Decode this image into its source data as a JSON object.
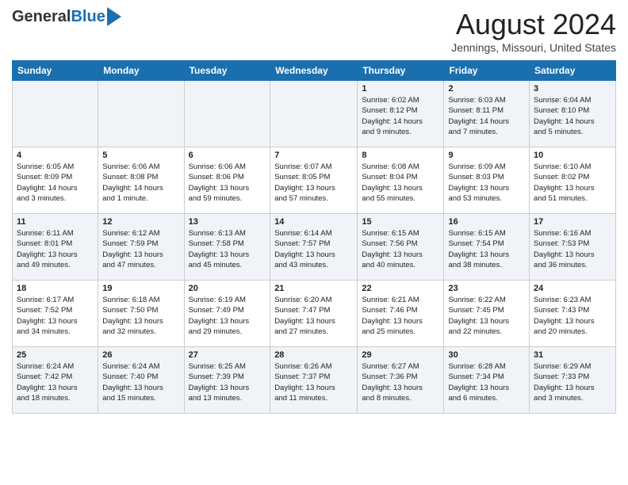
{
  "logo": {
    "general": "General",
    "blue": "Blue"
  },
  "title": "August 2024",
  "location": "Jennings, Missouri, United States",
  "days_of_week": [
    "Sunday",
    "Monday",
    "Tuesday",
    "Wednesday",
    "Thursday",
    "Friday",
    "Saturday"
  ],
  "weeks": [
    [
      {
        "day": "",
        "info": ""
      },
      {
        "day": "",
        "info": ""
      },
      {
        "day": "",
        "info": ""
      },
      {
        "day": "",
        "info": ""
      },
      {
        "day": "1",
        "info": "Sunrise: 6:02 AM\nSunset: 8:12 PM\nDaylight: 14 hours\nand 9 minutes."
      },
      {
        "day": "2",
        "info": "Sunrise: 6:03 AM\nSunset: 8:11 PM\nDaylight: 14 hours\nand 7 minutes."
      },
      {
        "day": "3",
        "info": "Sunrise: 6:04 AM\nSunset: 8:10 PM\nDaylight: 14 hours\nand 5 minutes."
      }
    ],
    [
      {
        "day": "4",
        "info": "Sunrise: 6:05 AM\nSunset: 8:09 PM\nDaylight: 14 hours\nand 3 minutes."
      },
      {
        "day": "5",
        "info": "Sunrise: 6:06 AM\nSunset: 8:08 PM\nDaylight: 14 hours\nand 1 minute."
      },
      {
        "day": "6",
        "info": "Sunrise: 6:06 AM\nSunset: 8:06 PM\nDaylight: 13 hours\nand 59 minutes."
      },
      {
        "day": "7",
        "info": "Sunrise: 6:07 AM\nSunset: 8:05 PM\nDaylight: 13 hours\nand 57 minutes."
      },
      {
        "day": "8",
        "info": "Sunrise: 6:08 AM\nSunset: 8:04 PM\nDaylight: 13 hours\nand 55 minutes."
      },
      {
        "day": "9",
        "info": "Sunrise: 6:09 AM\nSunset: 8:03 PM\nDaylight: 13 hours\nand 53 minutes."
      },
      {
        "day": "10",
        "info": "Sunrise: 6:10 AM\nSunset: 8:02 PM\nDaylight: 13 hours\nand 51 minutes."
      }
    ],
    [
      {
        "day": "11",
        "info": "Sunrise: 6:11 AM\nSunset: 8:01 PM\nDaylight: 13 hours\nand 49 minutes."
      },
      {
        "day": "12",
        "info": "Sunrise: 6:12 AM\nSunset: 7:59 PM\nDaylight: 13 hours\nand 47 minutes."
      },
      {
        "day": "13",
        "info": "Sunrise: 6:13 AM\nSunset: 7:58 PM\nDaylight: 13 hours\nand 45 minutes."
      },
      {
        "day": "14",
        "info": "Sunrise: 6:14 AM\nSunset: 7:57 PM\nDaylight: 13 hours\nand 43 minutes."
      },
      {
        "day": "15",
        "info": "Sunrise: 6:15 AM\nSunset: 7:56 PM\nDaylight: 13 hours\nand 40 minutes."
      },
      {
        "day": "16",
        "info": "Sunrise: 6:15 AM\nSunset: 7:54 PM\nDaylight: 13 hours\nand 38 minutes."
      },
      {
        "day": "17",
        "info": "Sunrise: 6:16 AM\nSunset: 7:53 PM\nDaylight: 13 hours\nand 36 minutes."
      }
    ],
    [
      {
        "day": "18",
        "info": "Sunrise: 6:17 AM\nSunset: 7:52 PM\nDaylight: 13 hours\nand 34 minutes."
      },
      {
        "day": "19",
        "info": "Sunrise: 6:18 AM\nSunset: 7:50 PM\nDaylight: 13 hours\nand 32 minutes."
      },
      {
        "day": "20",
        "info": "Sunrise: 6:19 AM\nSunset: 7:49 PM\nDaylight: 13 hours\nand 29 minutes."
      },
      {
        "day": "21",
        "info": "Sunrise: 6:20 AM\nSunset: 7:47 PM\nDaylight: 13 hours\nand 27 minutes."
      },
      {
        "day": "22",
        "info": "Sunrise: 6:21 AM\nSunset: 7:46 PM\nDaylight: 13 hours\nand 25 minutes."
      },
      {
        "day": "23",
        "info": "Sunrise: 6:22 AM\nSunset: 7:45 PM\nDaylight: 13 hours\nand 22 minutes."
      },
      {
        "day": "24",
        "info": "Sunrise: 6:23 AM\nSunset: 7:43 PM\nDaylight: 13 hours\nand 20 minutes."
      }
    ],
    [
      {
        "day": "25",
        "info": "Sunrise: 6:24 AM\nSunset: 7:42 PM\nDaylight: 13 hours\nand 18 minutes."
      },
      {
        "day": "26",
        "info": "Sunrise: 6:24 AM\nSunset: 7:40 PM\nDaylight: 13 hours\nand 15 minutes."
      },
      {
        "day": "27",
        "info": "Sunrise: 6:25 AM\nSunset: 7:39 PM\nDaylight: 13 hours\nand 13 minutes."
      },
      {
        "day": "28",
        "info": "Sunrise: 6:26 AM\nSunset: 7:37 PM\nDaylight: 13 hours\nand 11 minutes."
      },
      {
        "day": "29",
        "info": "Sunrise: 6:27 AM\nSunset: 7:36 PM\nDaylight: 13 hours\nand 8 minutes."
      },
      {
        "day": "30",
        "info": "Sunrise: 6:28 AM\nSunset: 7:34 PM\nDaylight: 13 hours\nand 6 minutes."
      },
      {
        "day": "31",
        "info": "Sunrise: 6:29 AM\nSunset: 7:33 PM\nDaylight: 13 hours\nand 3 minutes."
      }
    ]
  ]
}
